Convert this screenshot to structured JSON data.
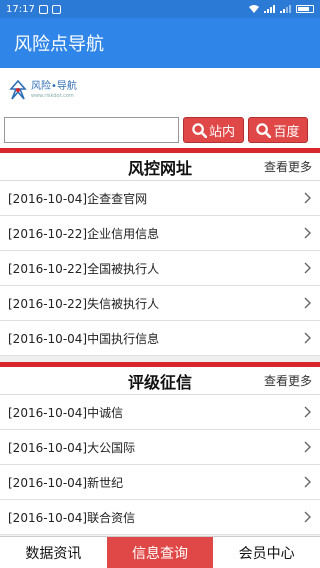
{
  "status": {
    "time": "17:17"
  },
  "app": {
    "title": "风险点导航"
  },
  "logo": {
    "name": "风险•导航",
    "url": "www.riskdot.com"
  },
  "search": {
    "placeholder": "",
    "value": "",
    "site_label": "站内",
    "baidu_label": "百度"
  },
  "sections": [
    {
      "title": "风控网址",
      "more": "查看更多",
      "items": [
        "[2016-10-04]企查查官网",
        "[2016-10-22]企业信用信息",
        "[2016-10-22]全国被执行人",
        "[2016-10-22]失信被执行人",
        "[2016-10-04]中国执行信息"
      ]
    },
    {
      "title": "评级征信",
      "more": "查看更多",
      "items": [
        "[2016-10-04]中诚信",
        "[2016-10-04]大公国际",
        "[2016-10-04]新世纪",
        "[2016-10-04]联合资信"
      ]
    }
  ],
  "nav": {
    "tabs": [
      "数据资讯",
      "信息查询",
      "会员中心"
    ],
    "active": "信息查询"
  },
  "colors": {
    "primary": "#2f86e8",
    "accent": "#e04848",
    "divider": "#d8262b"
  }
}
